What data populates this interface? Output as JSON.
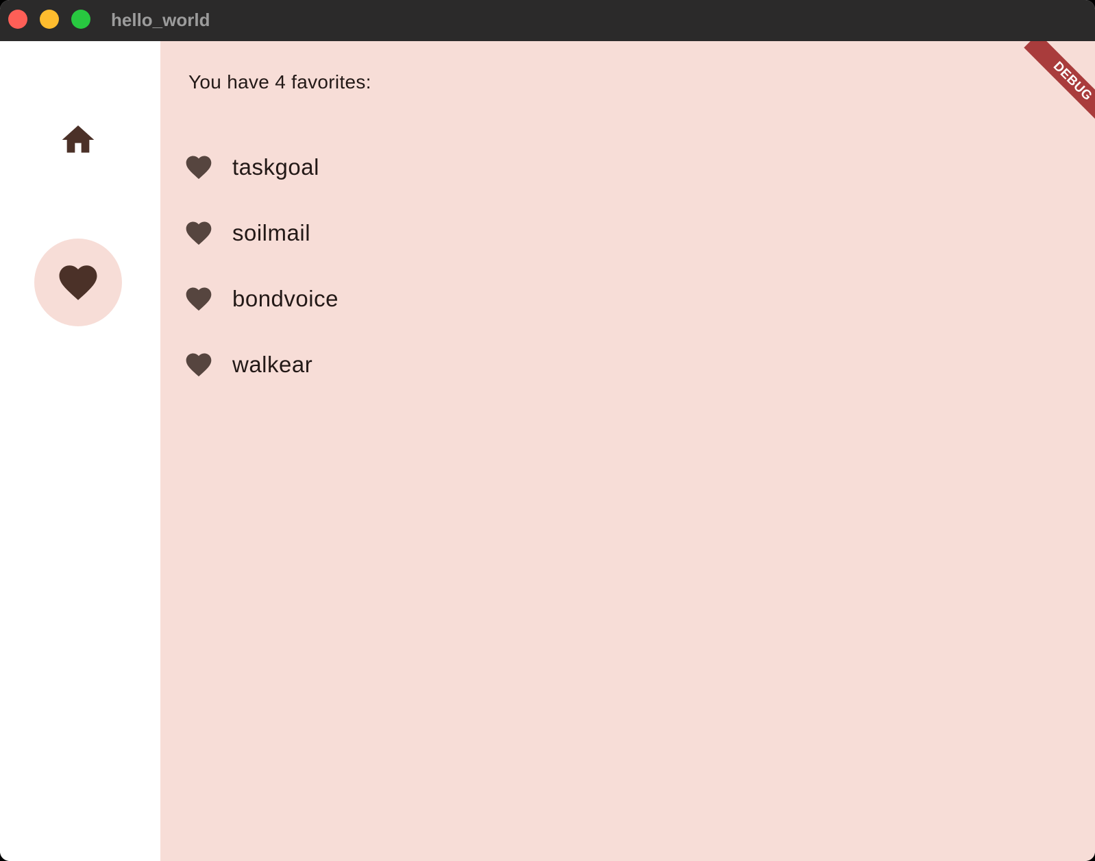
{
  "window": {
    "title": "hello_world"
  },
  "colors": {
    "background": "#f7ddd7",
    "icon": "#4b3128",
    "list_icon": "#56453f",
    "text": "#231917",
    "debug": "#a93c3c"
  },
  "rail": {
    "destinations": [
      {
        "icon": "home-icon",
        "selected": false
      },
      {
        "icon": "heart-icon",
        "selected": true
      }
    ]
  },
  "favorites": {
    "summary": "You have 4 favorites:",
    "items": [
      {
        "icon": "heart-icon",
        "label": "taskgoal"
      },
      {
        "icon": "heart-icon",
        "label": "soilmail"
      },
      {
        "icon": "heart-icon",
        "label": "bondvoice"
      },
      {
        "icon": "heart-icon",
        "label": "walkear"
      }
    ]
  },
  "debug_banner": {
    "label": "DEBUG"
  }
}
